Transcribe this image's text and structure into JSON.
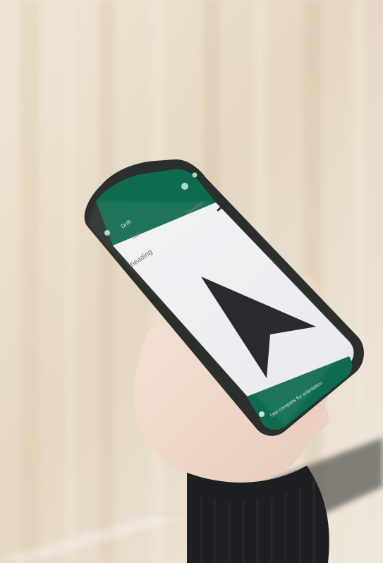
{
  "scene": {
    "background_color": "#e9dfcf",
    "accent": "#0f6b4f"
  },
  "phone_ui": {
    "header": {
      "title": "Drift",
      "icons": [
        "back-icon",
        "settings-icon",
        "more-icon"
      ]
    },
    "top_labels": {
      "left": "Turn",
      "right": "Direction"
    },
    "body_label": "heading",
    "main_icon": "navigation-arrow-icon",
    "bottom_bar": {
      "icon": "info-icon",
      "text": "Use compass for orientation"
    },
    "close_icon": "close-icon"
  }
}
